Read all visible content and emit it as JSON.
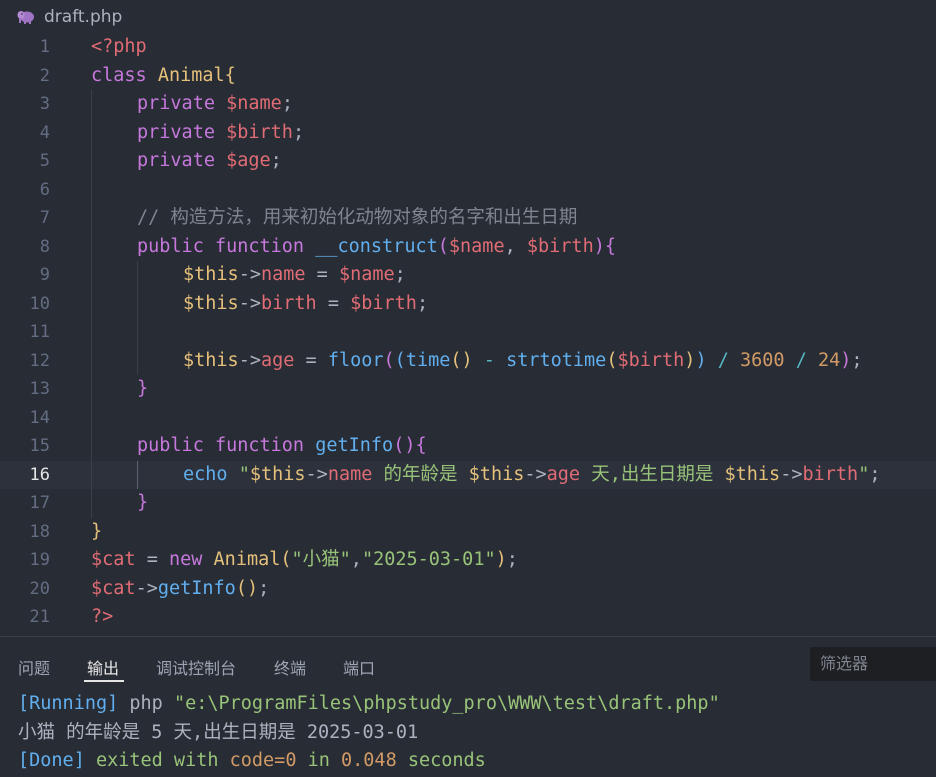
{
  "tab": {
    "title": "draft.php",
    "icon": "php-elephant-icon"
  },
  "editor": {
    "current_line": 16,
    "lines": [
      {
        "n": "1"
      },
      {
        "n": "2"
      },
      {
        "n": "3"
      },
      {
        "n": "4"
      },
      {
        "n": "5"
      },
      {
        "n": "6"
      },
      {
        "n": "7"
      },
      {
        "n": "8"
      },
      {
        "n": "9"
      },
      {
        "n": "10"
      },
      {
        "n": "11"
      },
      {
        "n": "12"
      },
      {
        "n": "13"
      },
      {
        "n": "14"
      },
      {
        "n": "15"
      },
      {
        "n": "16"
      },
      {
        "n": "17"
      },
      {
        "n": "18"
      },
      {
        "n": "19"
      },
      {
        "n": "20"
      },
      {
        "n": "21"
      }
    ],
    "tokens": {
      "l1": "<?php",
      "l2_kw": "class",
      "l2_cls": "Animal",
      "l2_b": "{",
      "private": "private",
      "l3_var": "$name",
      "l4_var": "$birth",
      "l5_var": "$age",
      "semi": ";",
      "l7_cmt": "// 构造方法，用来初始化动物对象的名字和出生日期",
      "public": "public",
      "function": "function",
      "l8_fn": "__construct",
      "l8_p1": "$name",
      "l8_comma": ", ",
      "l8_p2": "$birth",
      "this": "$this",
      "arrow": "->",
      "prop_name": "name",
      "prop_birth": "birth",
      "prop_age": "age",
      "eq": " = ",
      "l9_val": "$name",
      "l10_val": "$birth",
      "floor": "floor",
      "time": "time",
      "strtotime": "strtotime",
      "l12_arg": "$birth",
      "minus": " - ",
      "div": " / ",
      "n3600": "3600",
      "n24": "24",
      "getInfo": "getInfo",
      "echo": "echo",
      "s_open": " \"",
      "s_mid1": " 的年龄是 ",
      "s_mid2": " 天,出生日期是 ",
      "s_close": "\"",
      "l19_var": "$cat",
      "new": "new",
      "l19_cls": "Animal",
      "l19_s1": "\"小猫\"",
      "l19_comma": ",",
      "l19_s2": "\"2025-03-01\"",
      "l20_var": "$cat",
      "l20_fn": "getInfo",
      "l21": "?>"
    }
  },
  "panel": {
    "tabs": [
      {
        "label": "问题"
      },
      {
        "label": "输出"
      },
      {
        "label": "调试控制台"
      },
      {
        "label": "终端"
      },
      {
        "label": "端口"
      }
    ],
    "active_tab": "输出",
    "filter_placeholder": "筛选器"
  },
  "output": {
    "running_tag": "[Running]",
    "running_cmd": " php ",
    "running_path": "\"e:\\ProgramFiles\\phpstudy_pro\\WWW\\test\\draft.php\"",
    "result": "小猫 的年龄是 5 天,出生日期是 2025-03-01",
    "done_tag": "[Done]",
    "done_text1": " exited with ",
    "done_code": "code=0",
    "done_text2": " in ",
    "done_time": "0.048",
    "done_text3": " seconds"
  },
  "colors": {
    "background": "#282c34",
    "keyword": "#c678dd",
    "variable": "#e06c75",
    "class": "#e5c07b",
    "function": "#61afef",
    "string": "#98c379",
    "number": "#d19a66",
    "comment": "#7f848e",
    "operator": "#56b6c2"
  }
}
